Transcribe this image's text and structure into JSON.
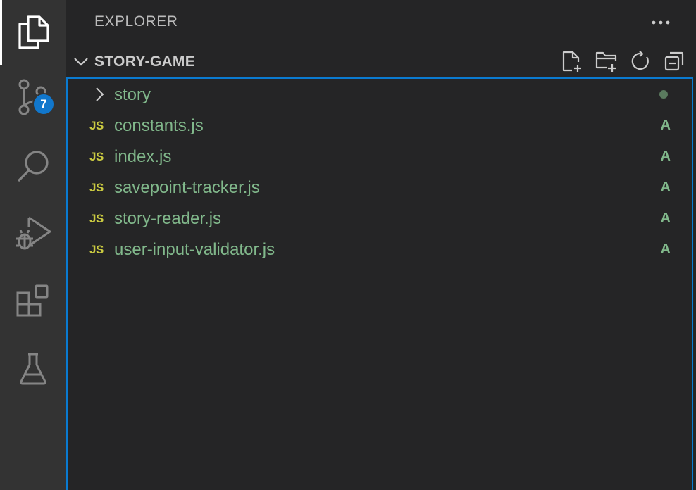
{
  "activity_bar": {
    "items": [
      {
        "name": "explorer",
        "icon": "files-icon"
      },
      {
        "name": "source-control",
        "icon": "source-control-icon",
        "badge": "7"
      },
      {
        "name": "search",
        "icon": "search-icon"
      },
      {
        "name": "run-debug",
        "icon": "run-debug-icon"
      },
      {
        "name": "extensions",
        "icon": "extensions-icon"
      },
      {
        "name": "testing",
        "icon": "beaker-icon"
      }
    ]
  },
  "sidebar": {
    "title": "EXPLORER",
    "more_actions_icon": "ellipsis-icon",
    "section": {
      "title": "STORY-GAME",
      "actions": [
        "new-file-icon",
        "new-folder-icon",
        "refresh-icon",
        "collapse-all-icon"
      ]
    },
    "tree": [
      {
        "type": "folder",
        "label": "story",
        "status": "•"
      },
      {
        "type": "file",
        "icon": "JS",
        "label": "constants.js",
        "status": "A"
      },
      {
        "type": "file",
        "icon": "JS",
        "label": "index.js",
        "status": "A"
      },
      {
        "type": "file",
        "icon": "JS",
        "label": "savepoint-tracker.js",
        "status": "A"
      },
      {
        "type": "file",
        "icon": "JS",
        "label": "story-reader.js",
        "status": "A"
      },
      {
        "type": "file",
        "icon": "JS",
        "label": "user-input-validator.js",
        "status": "A"
      }
    ]
  },
  "colors": {
    "activity_bar_bg": "#333333",
    "sidebar_bg": "#252526",
    "focus_border": "#0a7ad0",
    "git_added": "#81b88b",
    "js_icon": "#cbcb41",
    "badge": "#1177cc"
  }
}
